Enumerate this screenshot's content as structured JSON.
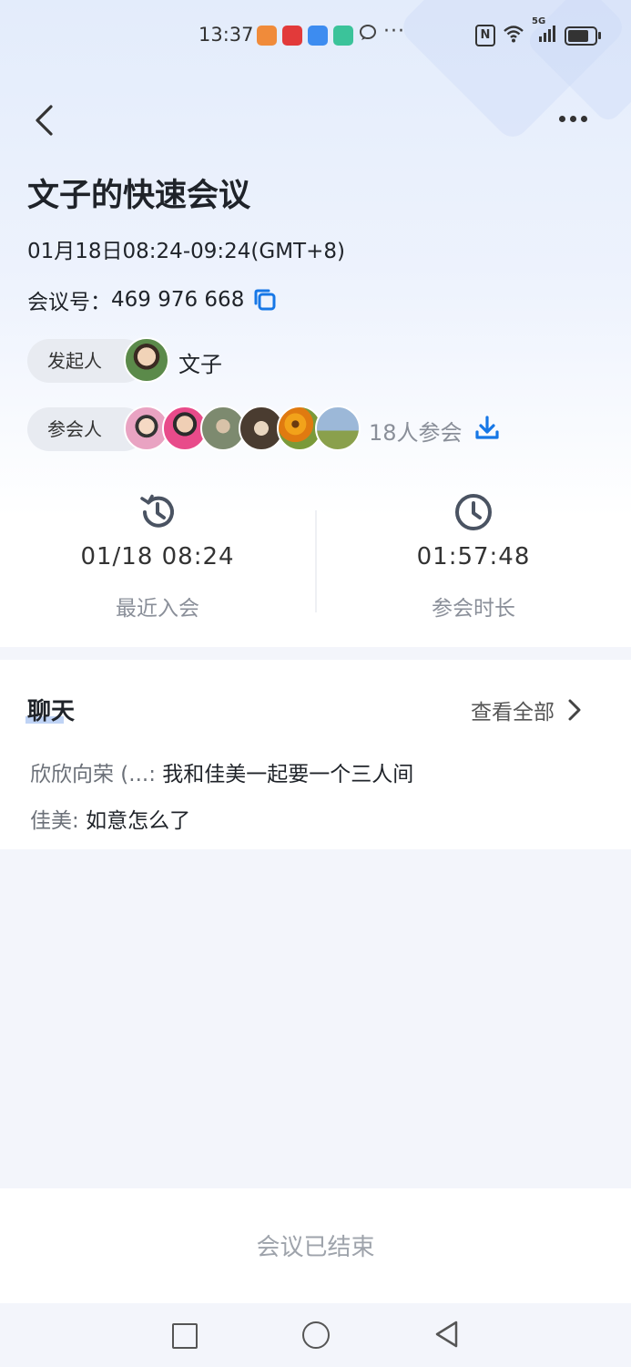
{
  "status_bar": {
    "time": "13:37",
    "overflow": "···",
    "network": "5G"
  },
  "header": {
    "title": "文子的快速会议",
    "time_range": "01月18日08:24-09:24(GMT+8)",
    "meeting_id_label": "会议号：",
    "meeting_id": "469 976 668"
  },
  "host": {
    "label": "发起人",
    "name": "文子"
  },
  "attendees": {
    "label": "参会人",
    "count_text": "18人参会",
    "avatars": [
      "avatar-1",
      "avatar-2",
      "avatar-3",
      "avatar-4",
      "avatar-5",
      "avatar-6"
    ]
  },
  "stats": {
    "recent_join_value": "01/18 08:24",
    "recent_join_label": "最近入会",
    "duration_value": "01:57:48",
    "duration_label": "参会时长"
  },
  "chat": {
    "title": "聊天",
    "view_all": "查看全部",
    "messages": [
      {
        "sender": "欣欣向荣 (...:",
        "text": "我和佳美一起要一个三人间"
      },
      {
        "sender": "佳美:",
        "text": "如意怎么了"
      }
    ]
  },
  "footer": {
    "status": "会议已结束"
  },
  "colors": {
    "accent": "#1677e6",
    "muted": "#8a8f99"
  }
}
